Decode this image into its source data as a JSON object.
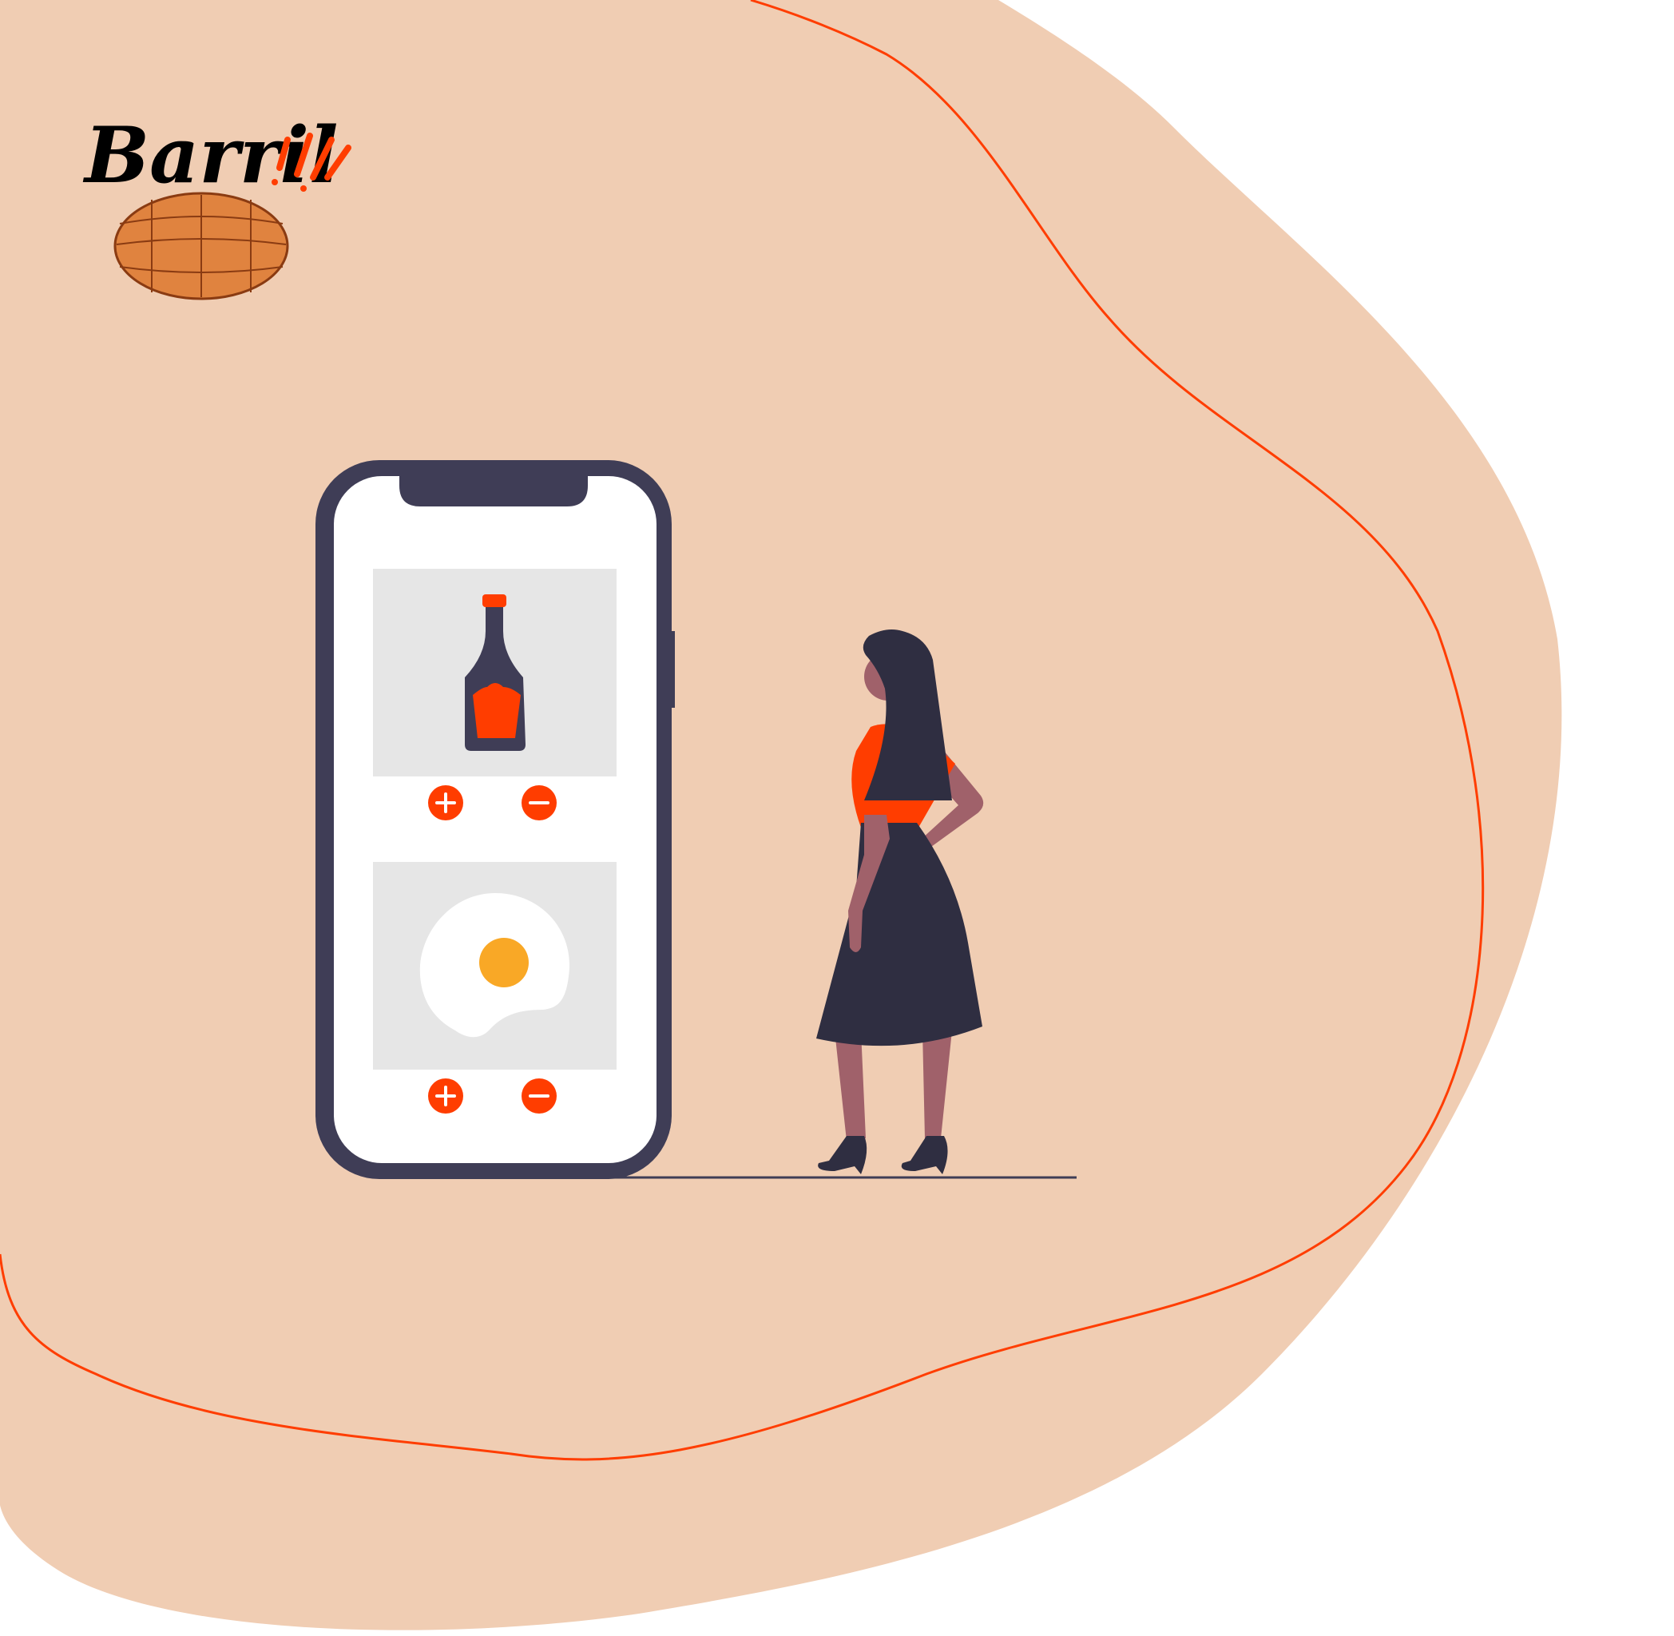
{
  "brand": {
    "name": "Barril",
    "icon": "barrel-icon"
  },
  "colors": {
    "background": "#ffffff",
    "blob": "#f0cdb3",
    "accent": "#ff3d00",
    "dark": "#3f3d56",
    "panel": "#e6e6e6",
    "barrel": "#e0833f",
    "yolk": "#f9a826"
  },
  "phone": {
    "products": [
      {
        "name": "sauce-bottle",
        "icon": "bottle-icon",
        "add_icon": "plus-icon",
        "remove_icon": "minus-icon"
      },
      {
        "name": "fried-egg",
        "icon": "egg-icon",
        "add_icon": "plus-icon",
        "remove_icon": "minus-icon"
      }
    ]
  }
}
